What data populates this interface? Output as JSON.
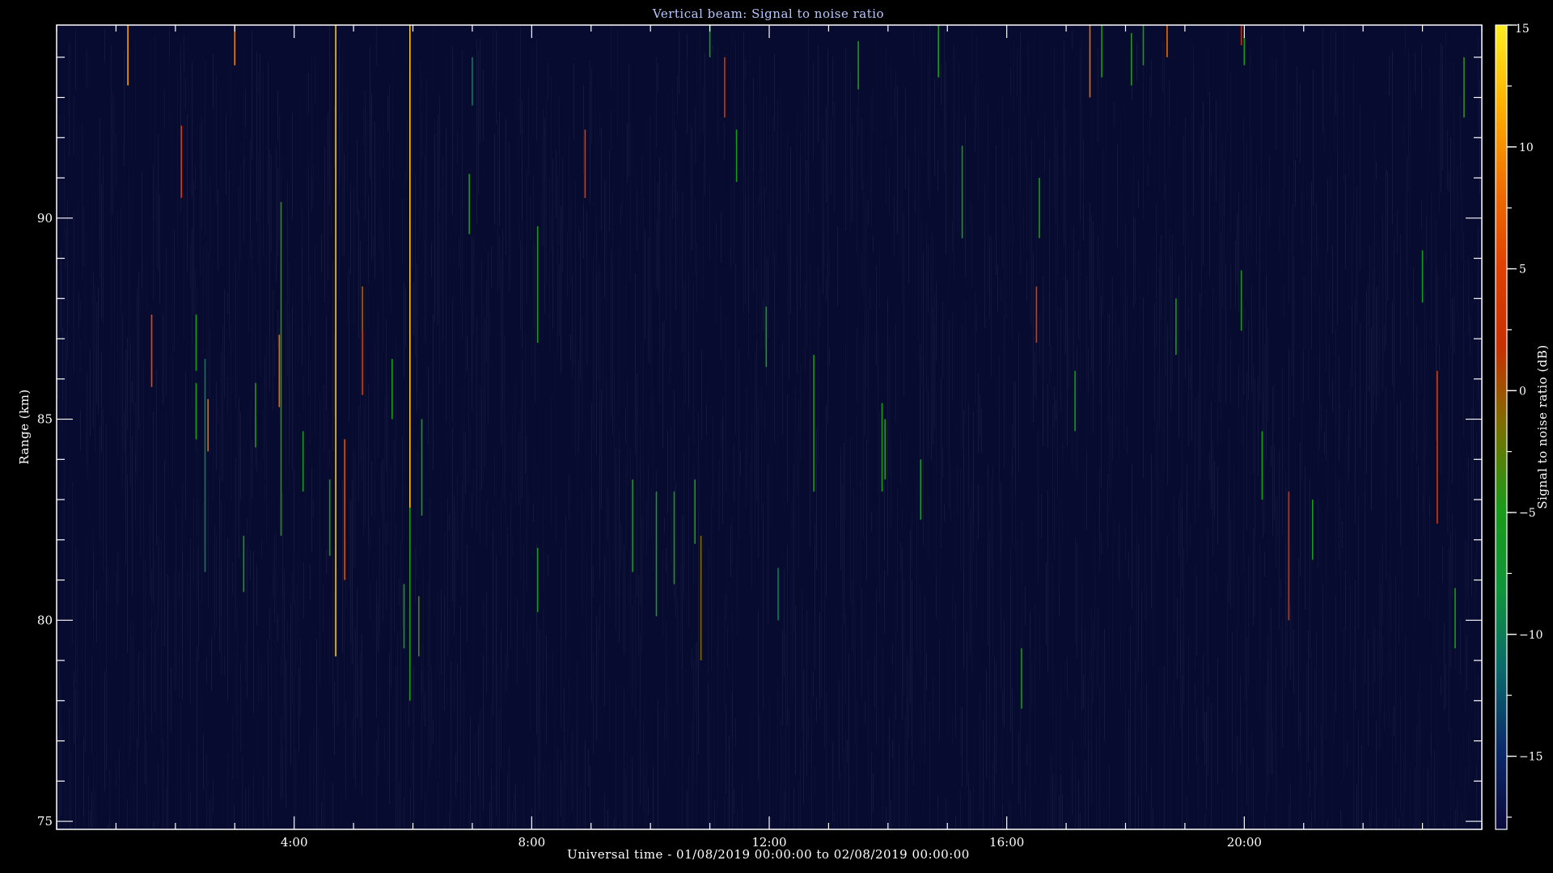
{
  "chart_data": {
    "type": "heatmap",
    "title": "Vertical beam: Signal to noise ratio",
    "xlabel": "Universal time - 01/08/2019 00:00:00 to 02/08/2019 00:00:00",
    "ylabel": "Range (km)",
    "colorbar_label": "Signal to noise ratio (dB)",
    "xlim": [
      0,
      24
    ],
    "ylim": [
      74.8,
      94.8
    ],
    "x_ticks": [
      4,
      8,
      12,
      16,
      20
    ],
    "x_tick_labels": [
      "4:00",
      "8:00",
      "12:00",
      "16:00",
      "20:00"
    ],
    "y_ticks": [
      75,
      80,
      85,
      90
    ],
    "y_tick_labels": [
      "75",
      "80",
      "85",
      "90"
    ],
    "colorbar_range": [
      -18,
      15
    ],
    "colorbar_ticks": [
      15,
      10,
      5,
      0,
      -5,
      -10,
      -15
    ],
    "colorbar_tick_labels": [
      "15",
      "10",
      "5",
      "0",
      "−5",
      "−10",
      "−15"
    ],
    "colors": {
      "background": "#000000",
      "plot_background": "#080b30",
      "axis": "#ffffff",
      "title": "#b7c8ff",
      "colormap": [
        "#0a0a3c",
        "#0b2a6a",
        "#0a6a6a",
        "#10963a",
        "#1a9a18",
        "#7a7000",
        "#c83000",
        "#e04000",
        "#f07000",
        "#ffb000",
        "#ffee20"
      ]
    },
    "grid": false,
    "echoes": [
      {
        "t": 1.2,
        "r0": 93.3,
        "r1": 94.8,
        "snr": 11
      },
      {
        "t": 1.6,
        "r0": 85.8,
        "r1": 87.6,
        "snr": 6
      },
      {
        "t": 2.1,
        "r0": 90.5,
        "r1": 92.3,
        "snr": 4
      },
      {
        "t": 2.55,
        "r0": 84.2,
        "r1": 85.5,
        "snr": 8
      },
      {
        "t": 2.35,
        "r0": 84.5,
        "r1": 85.9,
        "snr": -5
      },
      {
        "t": 2.35,
        "r0": 86.2,
        "r1": 87.6,
        "snr": -6
      },
      {
        "t": 2.5,
        "r0": 81.2,
        "r1": 86.5,
        "snr": -10
      },
      {
        "t": 3.0,
        "r0": 93.8,
        "r1": 94.8,
        "snr": 9
      },
      {
        "t": 3.15,
        "r0": 80.7,
        "r1": 82.1,
        "snr": -6
      },
      {
        "t": 3.35,
        "r0": 84.3,
        "r1": 85.9,
        "snr": -5
      },
      {
        "t": 3.75,
        "r0": 85.3,
        "r1": 87.1,
        "snr": 8
      },
      {
        "t": 3.78,
        "r0": 82.1,
        "r1": 90.4,
        "snr": -4
      },
      {
        "t": 4.15,
        "r0": 83.2,
        "r1": 84.7,
        "snr": -5
      },
      {
        "t": 4.6,
        "r0": 81.6,
        "r1": 83.5,
        "snr": -5
      },
      {
        "t": 4.7,
        "r0": 79.1,
        "r1": 94.8,
        "snr": 13
      },
      {
        "t": 4.85,
        "r0": 81.0,
        "r1": 84.5,
        "snr": 6
      },
      {
        "t": 5.15,
        "r0": 85.6,
        "r1": 88.3,
        "snr": 4
      },
      {
        "t": 5.15,
        "r0": 87.2,
        "r1": 88.3,
        "snr": 0
      },
      {
        "t": 5.65,
        "r0": 85.0,
        "r1": 86.5,
        "snr": -5
      },
      {
        "t": 5.85,
        "r0": 79.3,
        "r1": 80.9,
        "snr": -5
      },
      {
        "t": 5.95,
        "r0": 82.8,
        "r1": 94.8,
        "snr": 13
      },
      {
        "t": 5.95,
        "r0": 78.0,
        "r1": 82.8,
        "snr": -5
      },
      {
        "t": 6.1,
        "r0": 79.1,
        "r1": 80.6,
        "snr": -3
      },
      {
        "t": 6.15,
        "r0": 82.6,
        "r1": 85.0,
        "snr": -5
      },
      {
        "t": 6.95,
        "r0": 89.6,
        "r1": 91.1,
        "snr": -6
      },
      {
        "t": 7.0,
        "r0": 92.8,
        "r1": 94.0,
        "snr": -10
      },
      {
        "t": 8.1,
        "r0": 86.9,
        "r1": 89.8,
        "snr": -5
      },
      {
        "t": 8.1,
        "r0": 80.2,
        "r1": 81.8,
        "snr": -6
      },
      {
        "t": 8.9,
        "r0": 90.5,
        "r1": 92.2,
        "snr": 4
      },
      {
        "t": 9.7,
        "r0": 81.2,
        "r1": 83.5,
        "snr": -5
      },
      {
        "t": 10.1,
        "r0": 80.1,
        "r1": 83.2,
        "snr": -5
      },
      {
        "t": 10.4,
        "r0": 80.9,
        "r1": 83.2,
        "snr": -5
      },
      {
        "t": 10.75,
        "r0": 81.9,
        "r1": 83.5,
        "snr": -5
      },
      {
        "t": 10.85,
        "r0": 79.0,
        "r1": 82.1,
        "snr": -1
      },
      {
        "t": 11.0,
        "r0": 94.0,
        "r1": 94.8,
        "snr": -5
      },
      {
        "t": 11.25,
        "r0": 92.5,
        "r1": 94.0,
        "snr": 3
      },
      {
        "t": 11.45,
        "r0": 90.9,
        "r1": 92.2,
        "snr": -5
      },
      {
        "t": 11.95,
        "r0": 86.3,
        "r1": 87.8,
        "snr": -5
      },
      {
        "t": 12.15,
        "r0": 80.0,
        "r1": 81.3,
        "snr": -10
      },
      {
        "t": 12.75,
        "r0": 83.2,
        "r1": 86.6,
        "snr": -6
      },
      {
        "t": 13.5,
        "r0": 93.2,
        "r1": 94.4,
        "snr": -5
      },
      {
        "t": 13.9,
        "r0": 83.2,
        "r1": 85.4,
        "snr": -5
      },
      {
        "t": 13.95,
        "r0": 83.5,
        "r1": 85.0,
        "snr": -5
      },
      {
        "t": 14.55,
        "r0": 82.5,
        "r1": 84.0,
        "snr": -6
      },
      {
        "t": 14.85,
        "r0": 93.5,
        "r1": 94.8,
        "snr": -5
      },
      {
        "t": 15.25,
        "r0": 89.5,
        "r1": 91.8,
        "snr": -5
      },
      {
        "t": 16.25,
        "r0": 77.8,
        "r1": 79.3,
        "snr": -5
      },
      {
        "t": 16.5,
        "r0": 86.9,
        "r1": 88.3,
        "snr": 4
      },
      {
        "t": 16.55,
        "r0": 89.5,
        "r1": 91.0,
        "snr": -5
      },
      {
        "t": 17.15,
        "r0": 84.7,
        "r1": 86.2,
        "snr": -5
      },
      {
        "t": 17.4,
        "r0": 93.0,
        "r1": 94.8,
        "snr": 8
      },
      {
        "t": 17.6,
        "r0": 93.5,
        "r1": 94.8,
        "snr": -5
      },
      {
        "t": 18.1,
        "r0": 93.3,
        "r1": 94.6,
        "snr": -5
      },
      {
        "t": 18.3,
        "r0": 93.8,
        "r1": 94.8,
        "snr": -5
      },
      {
        "t": 18.7,
        "r0": 94.0,
        "r1": 94.8,
        "snr": 8
      },
      {
        "t": 18.85,
        "r0": 86.6,
        "r1": 88.0,
        "snr": -5
      },
      {
        "t": 19.95,
        "r0": 94.3,
        "r1": 94.8,
        "snr": 2
      },
      {
        "t": 20.0,
        "r0": 93.8,
        "r1": 94.5,
        "snr": -5
      },
      {
        "t": 19.95,
        "r0": 87.2,
        "r1": 88.7,
        "snr": -5
      },
      {
        "t": 20.3,
        "r0": 83.0,
        "r1": 84.7,
        "snr": -5
      },
      {
        "t": 20.75,
        "r0": 80.0,
        "r1": 83.2,
        "snr": 3
      },
      {
        "t": 21.15,
        "r0": 81.5,
        "r1": 83.0,
        "snr": -5
      },
      {
        "t": 23.25,
        "r0": 82.4,
        "r1": 86.2,
        "snr": 4
      },
      {
        "t": 23.0,
        "r0": 87.9,
        "r1": 89.2,
        "snr": -6
      },
      {
        "t": 23.55,
        "r0": 79.3,
        "r1": 80.8,
        "snr": -5
      },
      {
        "t": 23.7,
        "r0": 92.5,
        "r1": 94.0,
        "snr": -4
      }
    ]
  }
}
